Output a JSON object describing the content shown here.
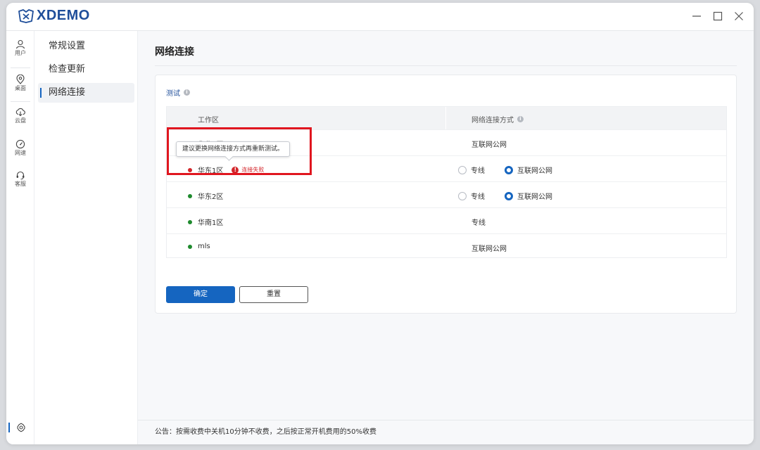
{
  "app": {
    "name": "XDEMO"
  },
  "window_controls": [
    {
      "icon": "minimize-icon"
    },
    {
      "icon": "maximize-icon"
    },
    {
      "icon": "close-icon"
    }
  ],
  "rail": {
    "items": [
      {
        "label": "用户",
        "icon": "user-icon"
      },
      {
        "label": "桌面",
        "icon": "location-pin-icon"
      },
      {
        "label": "云盘",
        "icon": "cloud-icon"
      },
      {
        "label": "网速",
        "icon": "speedometer-icon"
      },
      {
        "label": "客服",
        "icon": "headset-icon"
      }
    ],
    "bottom_icon": "settings-icon"
  },
  "subnav": {
    "items": [
      {
        "label": "常规设置",
        "active": false
      },
      {
        "label": "检查更新",
        "active": false
      },
      {
        "label": "网络连接",
        "active": true
      }
    ]
  },
  "main": {
    "title": "网络连接",
    "section_label": "测试",
    "table": {
      "headers": [
        "工作区",
        "网络连接方式"
      ],
      "rows": [
        {
          "name": "华北1区",
          "status_color": "#1e8a2d",
          "method": "互联网公网",
          "options": null,
          "error": null
        },
        {
          "name": "华东1区",
          "status_color": "#d3262b",
          "method": null,
          "options": [
            "专线",
            "互联网公网"
          ],
          "selected": "互联网公网",
          "error": "连接失败"
        },
        {
          "name": "华东2区",
          "status_color": "#1e8a2d",
          "method": null,
          "options": [
            "专线",
            "互联网公网"
          ],
          "selected": "互联网公网",
          "error": null
        },
        {
          "name": "华南1区",
          "status_color": "#1e8a2d",
          "method": "专线",
          "options": null,
          "error": null
        },
        {
          "name": "mls",
          "status_color": "#1e8a2d",
          "method": "互联网公网",
          "options": null,
          "error": null
        }
      ]
    },
    "tooltip": "建议更换网络连接方式再重新测试。",
    "buttons": {
      "confirm": "确定",
      "reset": "重置"
    }
  },
  "footer": {
    "notice": "公告：按需收费中关机10分钟不收费，之后按正常开机费用的50%收费"
  },
  "colors": {
    "accent": "#1565c0",
    "error": "#d3262b",
    "ok": "#1e8a2d",
    "annotation": "#e0161f"
  }
}
